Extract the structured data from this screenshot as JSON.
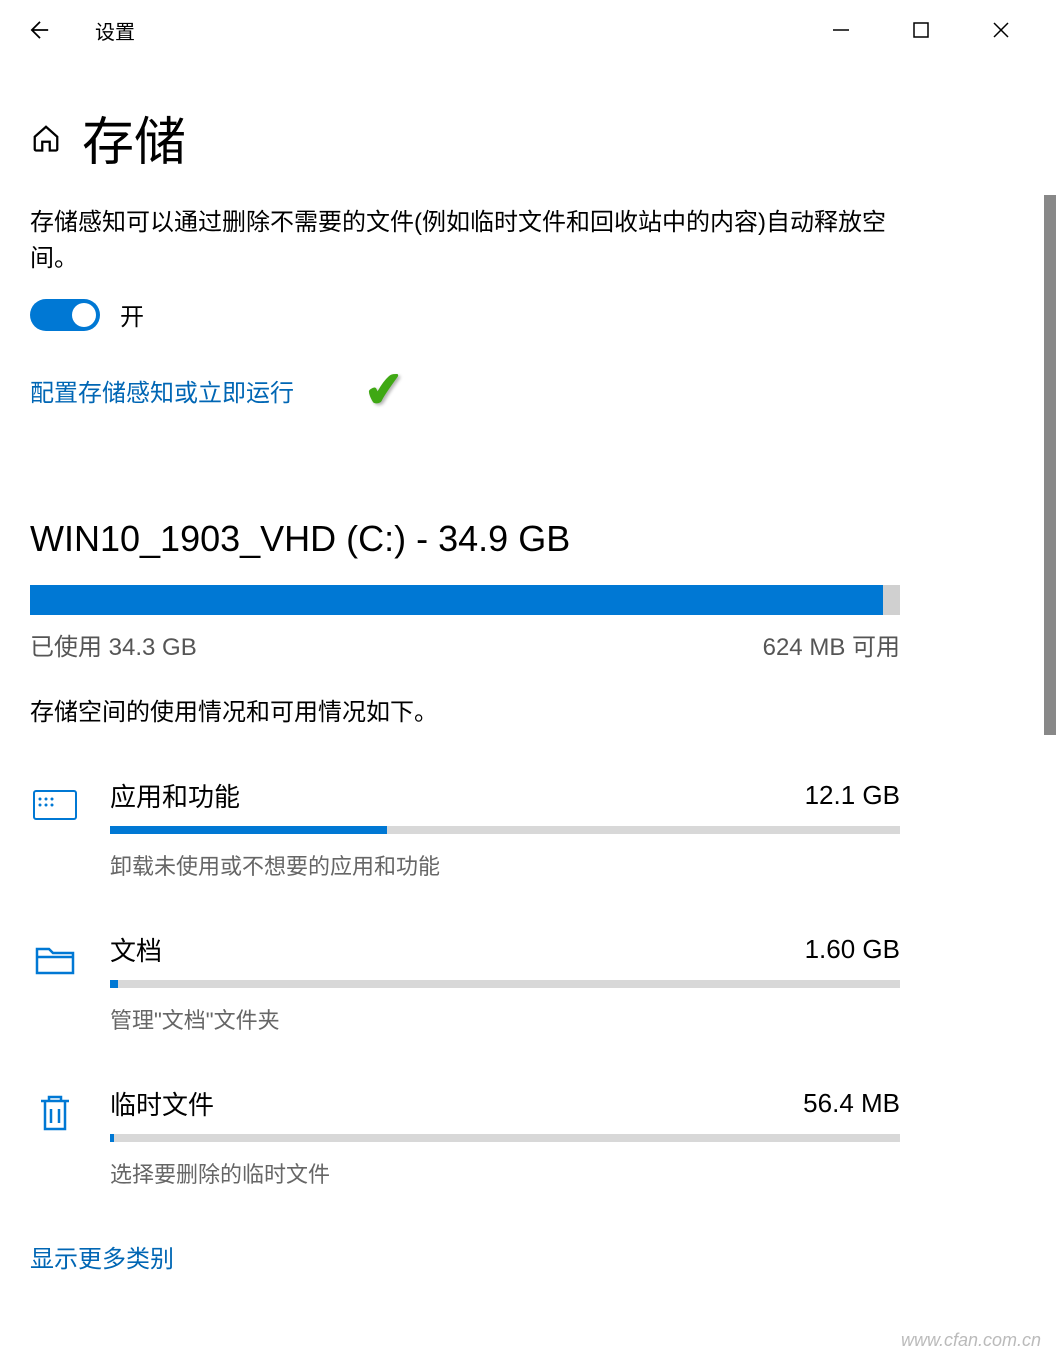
{
  "titlebar": {
    "title": "设置"
  },
  "page": {
    "title": "存储",
    "description": "存储感知可以通过删除不需要的文件(例如临时文件和回收站中的内容)自动释放空间。",
    "toggle_label": "开",
    "configure_link": "配置存储感知或立即运行"
  },
  "drive": {
    "title": "WIN10_1903_VHD (C:) - 34.9 GB",
    "used_label": "已使用 34.3 GB",
    "free_label": "624 MB 可用",
    "fill_percent": 98,
    "usage_desc": "存储空间的使用情况和可用情况如下。"
  },
  "categories": [
    {
      "name": "应用和功能",
      "size": "12.1 GB",
      "hint": "卸载未使用或不想要的应用和功能",
      "fill_percent": 35,
      "icon": "apps"
    },
    {
      "name": "文档",
      "size": "1.60 GB",
      "hint": "管理\"文档\"文件夹",
      "fill_percent": 1,
      "icon": "documents"
    },
    {
      "name": "临时文件",
      "size": "56.4 MB",
      "hint": "选择要删除的临时文件",
      "fill_percent": 0.5,
      "icon": "trash"
    }
  ],
  "show_more": "显示更多类别",
  "watermark": "www.cfan.com.cn"
}
